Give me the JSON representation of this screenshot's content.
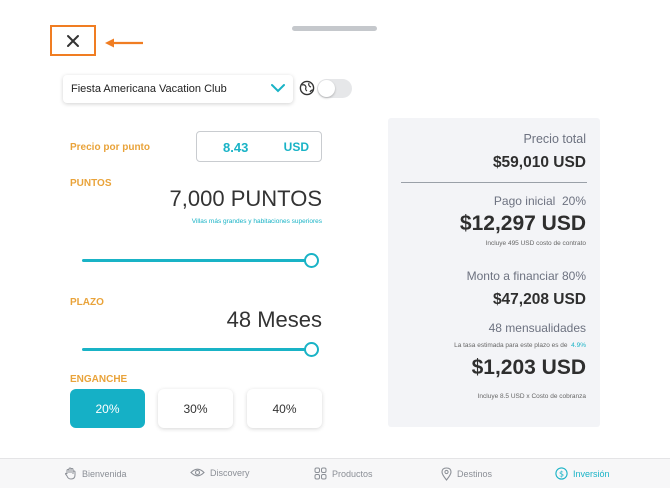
{
  "header": {
    "close_label": "✕"
  },
  "club_select": {
    "value": "Fiesta Americana Vacation Club"
  },
  "icons": {
    "globe": "globe-icon",
    "chevron": "chevron-down-icon",
    "close": "close-icon"
  },
  "price_per_point": {
    "label": "Precio por punto",
    "value": "8.43",
    "currency": "USD"
  },
  "points": {
    "label": "PUNTOS",
    "value": "7,000 PUNTOS",
    "caption": "Villas más grandes y habitaciones superiores",
    "slider_fraction": 1.0
  },
  "term": {
    "label": "PLAZO",
    "value": "48 Meses",
    "slider_fraction": 1.0
  },
  "down_payment": {
    "label": "ENGANCHE",
    "options": [
      "20%",
      "30%",
      "40%"
    ],
    "selected": "20%"
  },
  "summary": {
    "total_label": "Precio total",
    "total_value": "$59,010 USD",
    "initial_label": "Pago inicial",
    "initial_pct": "20%",
    "initial_value": "$12,297 USD",
    "initial_note": "Incluye  495 USD costo de contrato",
    "finance_label": "Monto a financiar 80%",
    "finance_value": "$47,208 USD",
    "months_label": "48 mensualidades",
    "rate_note": "La tasa estimada para este plazo es de",
    "rate_value": "4.9%",
    "monthly_value": "$1,203 USD",
    "monthly_note": "Incluye 8.5 USD x Costo de cobranza"
  },
  "nav": [
    {
      "label": "Bienvenida",
      "icon": "hand-icon"
    },
    {
      "label": "Discovery",
      "icon": "eye-icon"
    },
    {
      "label": "Productos",
      "icon": "grid-icon"
    },
    {
      "label": "Destinos",
      "icon": "location-pin-icon"
    },
    {
      "label": "Inversión",
      "icon": "dollar-icon",
      "active": true
    }
  ],
  "colors": {
    "accent": "#19b3c6",
    "orange_label": "#e9a33a",
    "annotation": "#f07d22"
  }
}
